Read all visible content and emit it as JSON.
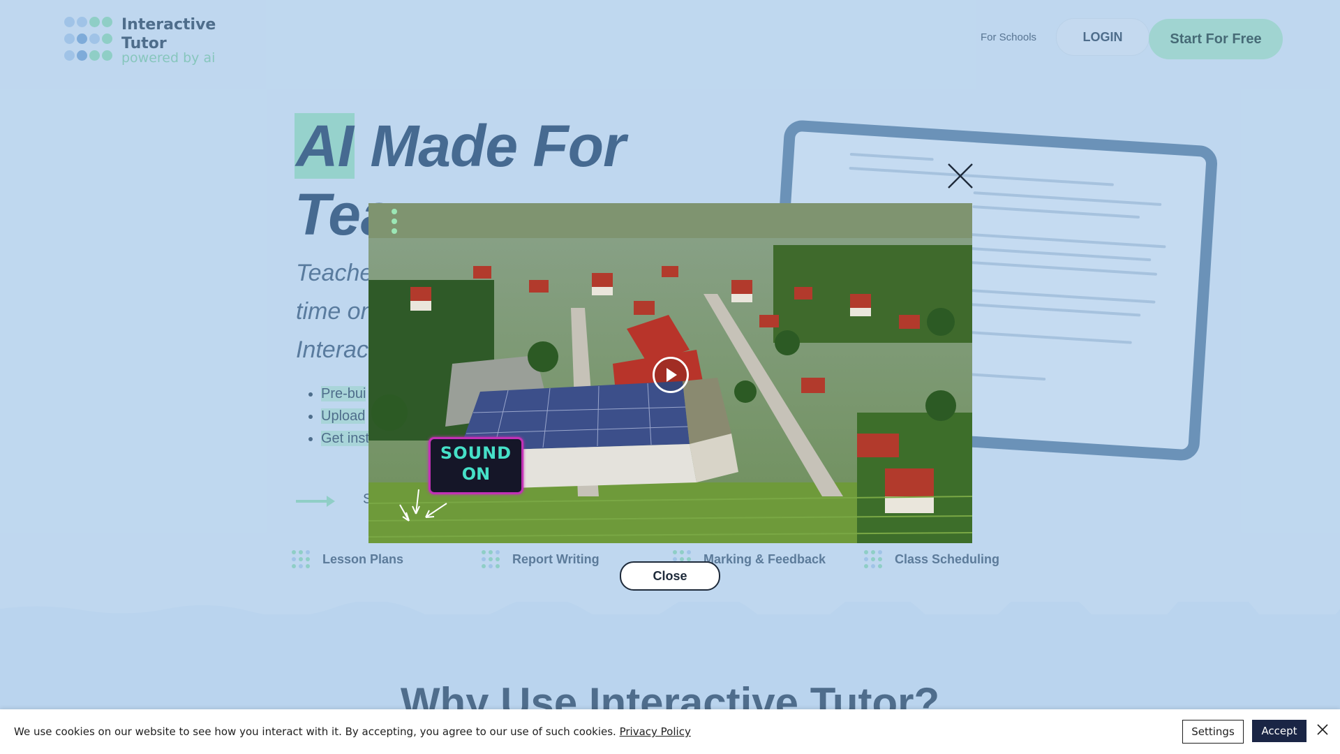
{
  "header": {
    "logo_line1": "Interactive",
    "logo_line2": "Tutor",
    "logo_sub": "powered by ai",
    "nav_for_schools": "For Schools",
    "nav_login": "LOGIN",
    "nav_start": "Start For Free"
  },
  "hero": {
    "headline_highlight": "AI",
    "headline_rest": " Made For",
    "headline_line2": "Tea",
    "sub_line1": "Teache",
    "sub_line2": "time on",
    "sub_line3": "Interac",
    "bullets": [
      "Pre-bui",
      "Upload",
      "Get inst"
    ],
    "cta_partial": "S"
  },
  "features": [
    "Lesson Plans",
    "Report Writing",
    "Marking & Feedback",
    "Class Scheduling"
  ],
  "section": {
    "why_title": "Why Use Interactive Tutor?"
  },
  "modal": {
    "sound_line1": "SOUND",
    "sound_line2": "ON",
    "close_label": "Close"
  },
  "cookie": {
    "message": "We use cookies on our website to see how you interact with it. By accepting, you agree to our use of such cookies.",
    "policy_link": "Privacy Policy",
    "settings_label": "Settings",
    "accept_label": "Accept"
  },
  "colors": {
    "brand_green": "#9ce6b5",
    "navy": "#1a2545",
    "overlay_tint": "#7eafde",
    "neon_teal": "#46e0c8",
    "neon_magenta": "#c231b5"
  },
  "icons": {
    "modal_close": "close-icon",
    "play": "play-icon",
    "cookie_close": "close-icon"
  }
}
